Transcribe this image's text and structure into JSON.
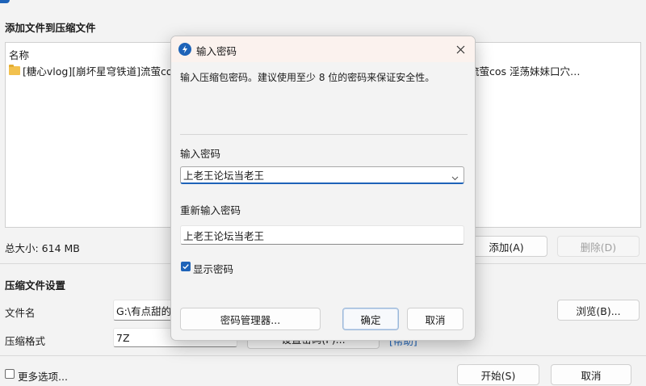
{
  "main": {
    "add_files_title": "添加文件到压缩文件",
    "list": {
      "header_name": "名称",
      "item_text": "[糖心vlog][崩坏星穹铁道]流萤cos",
      "item_text_right": "流萤cos 淫荡妹妹口穴…"
    },
    "total_size": "总大小: 614 MB",
    "add_button": "添加(A)",
    "delete_button": "删除(D)",
    "settings_title": "压缩文件设置",
    "filename_label": "文件名",
    "filename_value": "G:\\有点甜的",
    "browse_button": "浏览(B)...",
    "format_label": "压缩格式",
    "format_value": "7Z",
    "set_password_button": "设置密码(P)...",
    "help_link": "[帮助]",
    "more_options_label": "更多选项...",
    "start_button": "开始(S)",
    "cancel_button": "取消"
  },
  "dialog": {
    "title": "输入密码",
    "description": "输入压缩包密码。建议使用至少 8 位的密码来保证安全性。",
    "password_label": "输入密码",
    "password_value": "上老王论坛当老王",
    "reenter_label": "重新输入密码",
    "reenter_value": "上老王论坛当老王",
    "show_password_label": "显示密码",
    "show_password_checked": true,
    "manager_button": "密码管理器...",
    "ok_button": "确定",
    "cancel_button": "取消",
    "accent_color": "#1e63b8"
  }
}
